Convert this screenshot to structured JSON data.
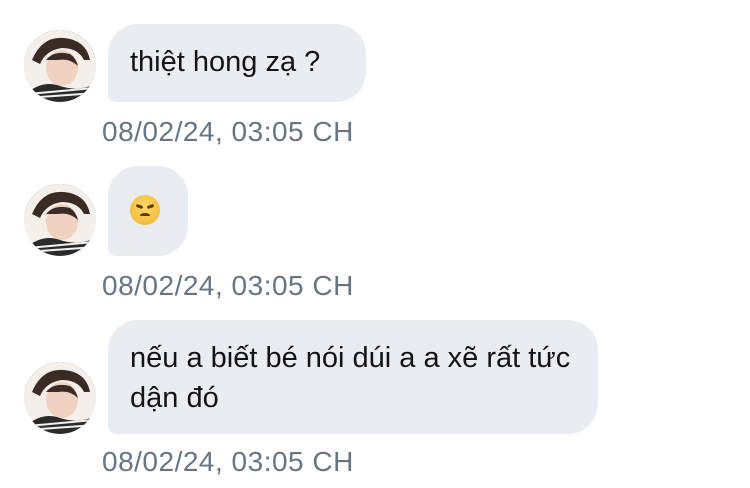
{
  "messages": [
    {
      "text": "thiệt hong zạ ?",
      "time": "08/02/24, 03:05 CH",
      "type": "text"
    },
    {
      "text": "😠",
      "time": "08/02/24, 03:05 CH",
      "type": "emoji",
      "icon": "angry-face-emoji"
    },
    {
      "text": "nếu a biết bé nói dúi a a xẽ rất tức dận đó",
      "time": "08/02/24, 03:05 CH",
      "type": "text"
    }
  ],
  "colors": {
    "bubble": "#e9edf2",
    "text": "#111418",
    "timestamp": "#677583"
  }
}
